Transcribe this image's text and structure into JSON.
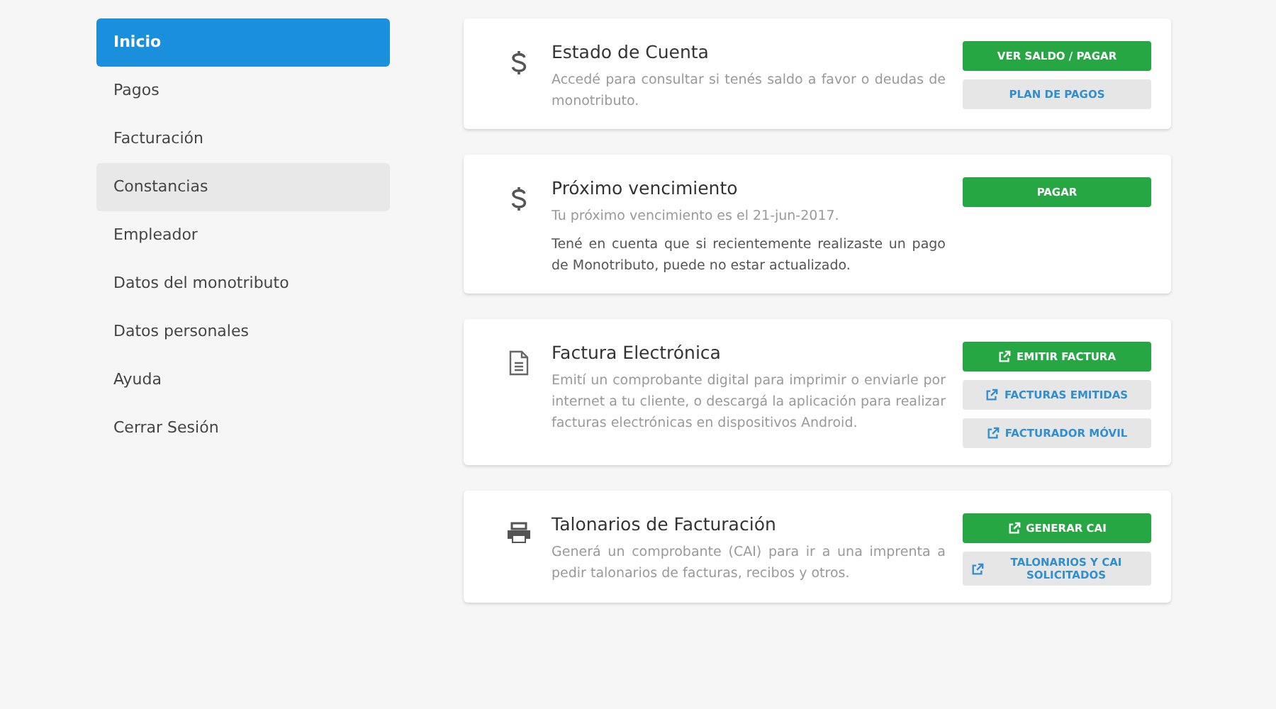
{
  "sidebar": {
    "items": [
      {
        "label": "Inicio",
        "selected": true,
        "highlighted": false
      },
      {
        "label": "Pagos",
        "selected": false,
        "highlighted": false
      },
      {
        "label": "Facturación",
        "selected": false,
        "highlighted": false
      },
      {
        "label": "Constancias",
        "selected": false,
        "highlighted": true
      },
      {
        "label": "Empleador",
        "selected": false,
        "highlighted": false
      },
      {
        "label": "Datos del monotributo",
        "selected": false,
        "highlighted": false
      },
      {
        "label": "Datos personales",
        "selected": false,
        "highlighted": false
      },
      {
        "label": "Ayuda",
        "selected": false,
        "highlighted": false
      },
      {
        "label": "Cerrar Sesión",
        "selected": false,
        "highlighted": false
      }
    ]
  },
  "cards": [
    {
      "kind": "dollar",
      "title": "Estado de Cuenta",
      "paragraphs": [
        {
          "kind": "muted",
          "text": "Accedé para consultar si tenés saldo a favor o deudas de monotributo."
        }
      ],
      "buttons": [
        {
          "kind": "primary",
          "external": false,
          "label": "VER SALDO / PAGAR"
        },
        {
          "kind": "secondary",
          "external": false,
          "label": "PLAN DE PAGOS"
        }
      ]
    },
    {
      "kind": "dollar",
      "title": "Próximo vencimiento",
      "paragraphs": [
        {
          "kind": "muted",
          "text": "Tu próximo vencimiento es el 21-jun-2017."
        },
        {
          "kind": "normal",
          "text": "Tené en cuenta que si recientemente realizaste un pago de Monotributo, puede no estar actualizado."
        }
      ],
      "buttons": [
        {
          "kind": "primary",
          "external": false,
          "label": "PAGAR"
        }
      ]
    },
    {
      "kind": "document",
      "title": "Factura Electrónica",
      "paragraphs": [
        {
          "kind": "muted",
          "text": "Emití un comprobante digital para imprimir o enviarle por internet a tu cliente, o descargá la aplicación para realizar facturas electrónicas en dispositivos Android."
        }
      ],
      "buttons": [
        {
          "kind": "primary",
          "external": true,
          "label": "EMITIR FACTURA"
        },
        {
          "kind": "secondary",
          "external": true,
          "label": "FACTURAS EMITIDAS"
        },
        {
          "kind": "secondary",
          "external": true,
          "label": "FACTURADOR MÓVIL"
        }
      ]
    },
    {
      "kind": "printer",
      "title": "Talonarios de Facturación",
      "paragraphs": [
        {
          "kind": "muted",
          "text": "Generá un comprobante (CAI) para ir a una imprenta a pedir talonarios de facturas, recibos y otros."
        }
      ],
      "buttons": [
        {
          "kind": "primary",
          "external": true,
          "label": "GENERAR CAI"
        },
        {
          "kind": "secondary",
          "external": true,
          "label": "TALONARIOS Y CAI SOLICITADOS"
        }
      ]
    }
  ]
}
